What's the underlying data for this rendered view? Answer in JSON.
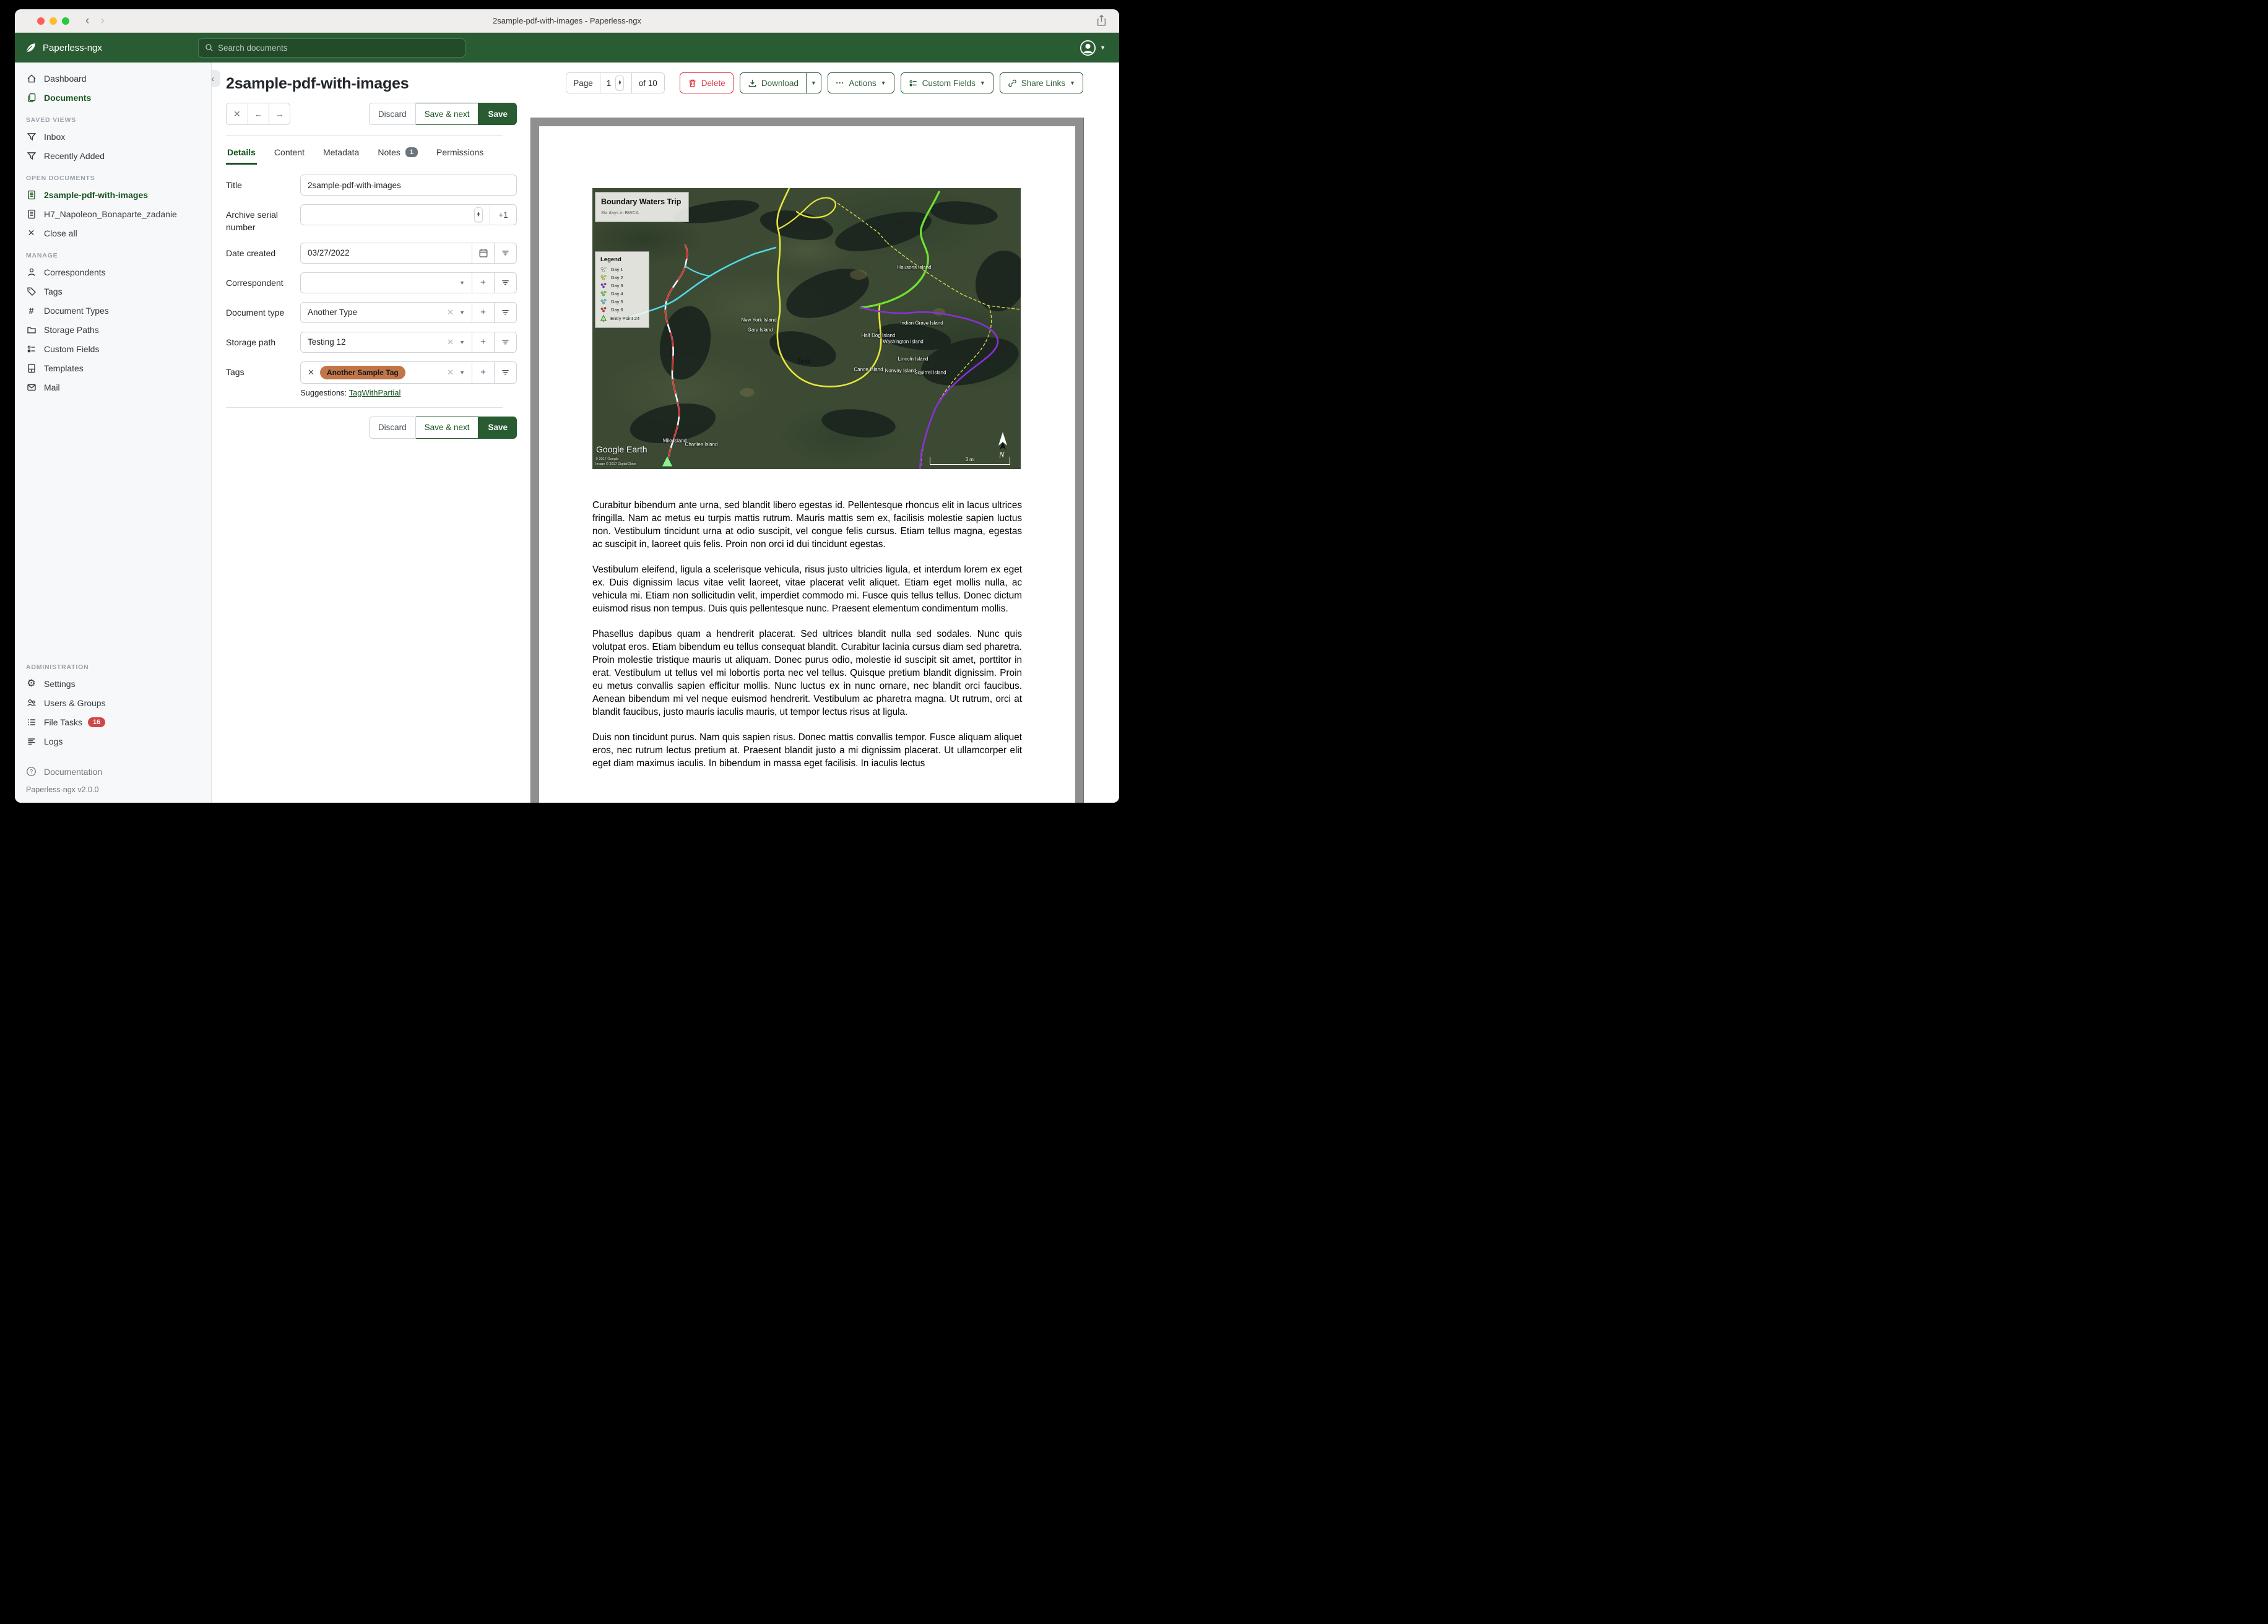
{
  "window": {
    "title": "2sample-pdf-with-images - Paperless-ngx"
  },
  "header": {
    "app_name": "Paperless-ngx",
    "search_placeholder": "Search documents"
  },
  "sidebar": {
    "primary": [
      {
        "label": "Dashboard",
        "icon": "home"
      },
      {
        "label": "Documents",
        "icon": "documents",
        "active": true
      }
    ],
    "sections": [
      {
        "title": "SAVED VIEWS",
        "admin": false,
        "items": [
          {
            "label": "Inbox",
            "icon": "funnel"
          },
          {
            "label": "Recently Added",
            "icon": "funnel"
          }
        ]
      },
      {
        "title": "OPEN DOCUMENTS",
        "admin": false,
        "items": [
          {
            "label": "2sample-pdf-with-images",
            "icon": "file",
            "active": true
          },
          {
            "label": "H7_Napoleon_Bonaparte_zadanie",
            "icon": "file"
          },
          {
            "label": "Close all",
            "icon": "close"
          }
        ]
      },
      {
        "title": "MANAGE",
        "admin": false,
        "items": [
          {
            "label": "Correspondents",
            "icon": "person"
          },
          {
            "label": "Tags",
            "icon": "tag"
          },
          {
            "label": "Document Types",
            "icon": "hash"
          },
          {
            "label": "Storage Paths",
            "icon": "folder"
          },
          {
            "label": "Custom Fields",
            "icon": "fields"
          },
          {
            "label": "Templates",
            "icon": "template"
          },
          {
            "label": "Mail",
            "icon": "mail"
          }
        ]
      },
      {
        "title": "ADMINISTRATION",
        "admin": true,
        "items": [
          {
            "label": "Settings",
            "icon": "gear"
          },
          {
            "label": "Users & Groups",
            "icon": "users"
          },
          {
            "label": "File Tasks",
            "icon": "tasks",
            "badge": "16"
          },
          {
            "label": "Logs",
            "icon": "logs"
          }
        ]
      }
    ],
    "documentation": "Documentation",
    "version": "Paperless-ngx v2.0.0"
  },
  "toolbar": {
    "page_label": "Page",
    "page_value": "1",
    "page_total": "of 10",
    "delete_label": "Delete",
    "download_label": "Download",
    "actions_label": "Actions",
    "custom_fields_label": "Custom Fields",
    "share_links_label": "Share Links"
  },
  "document": {
    "title": "2sample-pdf-with-images",
    "actions": {
      "discard": "Discard",
      "save_next": "Save & next",
      "save": "Save"
    },
    "tabs": [
      {
        "label": "Details",
        "active": true
      },
      {
        "label": "Content"
      },
      {
        "label": "Metadata"
      },
      {
        "label": "Notes",
        "badge": "1"
      },
      {
        "label": "Permissions"
      }
    ],
    "form": {
      "title": {
        "label": "Title",
        "value": "2sample-pdf-with-images"
      },
      "asn": {
        "label": "Archive serial number",
        "value": "",
        "plus_one": "+1"
      },
      "date_created": {
        "label": "Date created",
        "value": "03/27/2022"
      },
      "correspondent": {
        "label": "Correspondent",
        "value": ""
      },
      "document_type": {
        "label": "Document type",
        "value": "Another Type"
      },
      "storage_path": {
        "label": "Storage path",
        "value": "Testing 12"
      },
      "tags": {
        "label": "Tags",
        "chips": [
          {
            "label": "Another Sample Tag",
            "color": "#c1764a"
          }
        ],
        "suggestions_label": "Suggestions:",
        "suggestions": [
          "TagWithPartial"
        ]
      }
    }
  },
  "preview": {
    "map": {
      "title": "Boundary Waters Trip",
      "subtitle": "Six days in BWCA",
      "legend_title": "Legend",
      "legend_items": [
        {
          "label": "Day 1",
          "color": "#e9eef0"
        },
        {
          "label": "Day 2",
          "color": "#e6e63c"
        },
        {
          "label": "Day 3",
          "color": "#8b30d8"
        },
        {
          "label": "Day 4",
          "color": "#70e332"
        },
        {
          "label": "Day 5",
          "color": "#4fd9e3"
        },
        {
          "label": "Day 6",
          "color": "#d83030"
        },
        {
          "label": "Entry Point 24",
          "color": "#8ef08e",
          "icon": "tree"
        }
      ],
      "island_labels": [
        "Hausons Island",
        "New York Island",
        "Gary Island",
        "Indian Grave Island",
        "Half Dog Island",
        "Washington Island",
        "Lincoln Island",
        "Canoe Island",
        "Norway Island",
        "Squirrel Island",
        "Mile Island",
        "Charlies Island"
      ],
      "center_label": "Text",
      "credit": "Google Earth",
      "copyright1": "© 2017 Google",
      "copyright2": "Image © 2017 DigitalGlobe",
      "scale_label": "3 mi",
      "north_label": "N"
    },
    "paragraphs": [
      "Curabitur bibendum ante urna, sed blandit libero egestas id. Pellentesque rhoncus elit in lacus ultrices fringilla. Nam ac metus eu turpis mattis rutrum. Mauris mattis sem ex, facilisis molestie sapien luctus non. Vestibulum tincidunt urna at odio suscipit, vel congue felis cursus. Etiam tellus magna, egestas ac suscipit in, laoreet quis felis. Proin non orci id dui tincidunt egestas.",
      "Vestibulum eleifend, ligula a scelerisque vehicula, risus justo ultricies ligula, et interdum lorem ex eget ex. Duis dignissim lacus vitae velit laoreet, vitae placerat velit aliquet. Etiam eget mollis nulla, ac vehicula mi. Etiam non sollicitudin velit, imperdiet commodo mi. Fusce quis tellus tellus. Donec dictum euismod risus non tempus. Duis quis pellentesque nunc. Praesent elementum condimentum mollis.",
      "Phasellus dapibus quam a hendrerit placerat. Sed ultrices blandit nulla sed sodales. Nunc quis volutpat eros. Etiam bibendum eu tellus consequat blandit. Curabitur lacinia cursus diam sed pharetra. Proin molestie tristique mauris ut aliquam. Donec purus odio, molestie id suscipit sit amet, porttitor in erat. Vestibulum ut tellus vel mi lobortis porta nec vel tellus. Quisque pretium blandit dignissim. Proin eu metus convallis sapien efficitur mollis. Nunc luctus ex in nunc ornare, nec blandit orci faucibus. Aenean bibendum mi vel neque euismod hendrerit. Vestibulum ac pharetra magna. Ut rutrum, orci at blandit faucibus, justo mauris iaculis mauris, ut tempor lectus risus at ligula.",
      "Duis non tincidunt purus. Nam quis sapien risus. Donec mattis convallis tempor. Fusce aliquam aliquet eros, nec rutrum lectus pretium at. Praesent blandit justo a mi dignissim placerat. Ut ullamcorper elit eget diam maximus iaculis. In bibendum in massa eget facilisis. In iaculis lectus"
    ]
  },
  "colors": {
    "header_green": "#2a5c33",
    "accent_green": "#17541f",
    "delete_red": "#dc3545",
    "tag_chip": "#c1764a",
    "file_tasks_badge": "#d04545"
  }
}
